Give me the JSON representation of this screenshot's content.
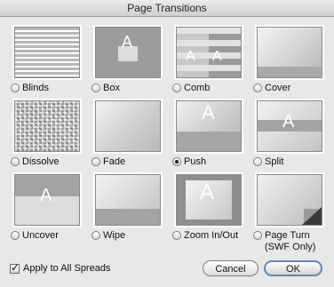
{
  "window": {
    "title": "Page Transitions"
  },
  "transitions": [
    {
      "label": "Blinds",
      "selected": false,
      "icon": "blinds-preview"
    },
    {
      "label": "Box",
      "selected": false,
      "icon": "box-preview"
    },
    {
      "label": "Comb",
      "selected": false,
      "icon": "comb-preview"
    },
    {
      "label": "Cover",
      "selected": false,
      "icon": "cover-preview"
    },
    {
      "label": "Dissolve",
      "selected": false,
      "icon": "dissolve-preview"
    },
    {
      "label": "Fade",
      "selected": false,
      "icon": "fade-preview"
    },
    {
      "label": "Push",
      "selected": true,
      "icon": "push-preview"
    },
    {
      "label": "Split",
      "selected": false,
      "icon": "split-preview"
    },
    {
      "label": "Uncover",
      "selected": false,
      "icon": "uncover-preview"
    },
    {
      "label": "Wipe",
      "selected": false,
      "icon": "wipe-preview"
    },
    {
      "label": "Zoom In/Out",
      "selected": false,
      "icon": "zoom-preview"
    },
    {
      "label": "Page Turn",
      "label_line2": "(SWF Only)",
      "selected": false,
      "icon": "page-turn-preview"
    }
  ],
  "preview_glyph": "A",
  "footer": {
    "apply_all_label": "Apply to All Spreads",
    "apply_all_checked": true,
    "cancel_label": "Cancel",
    "ok_label": "OK"
  }
}
